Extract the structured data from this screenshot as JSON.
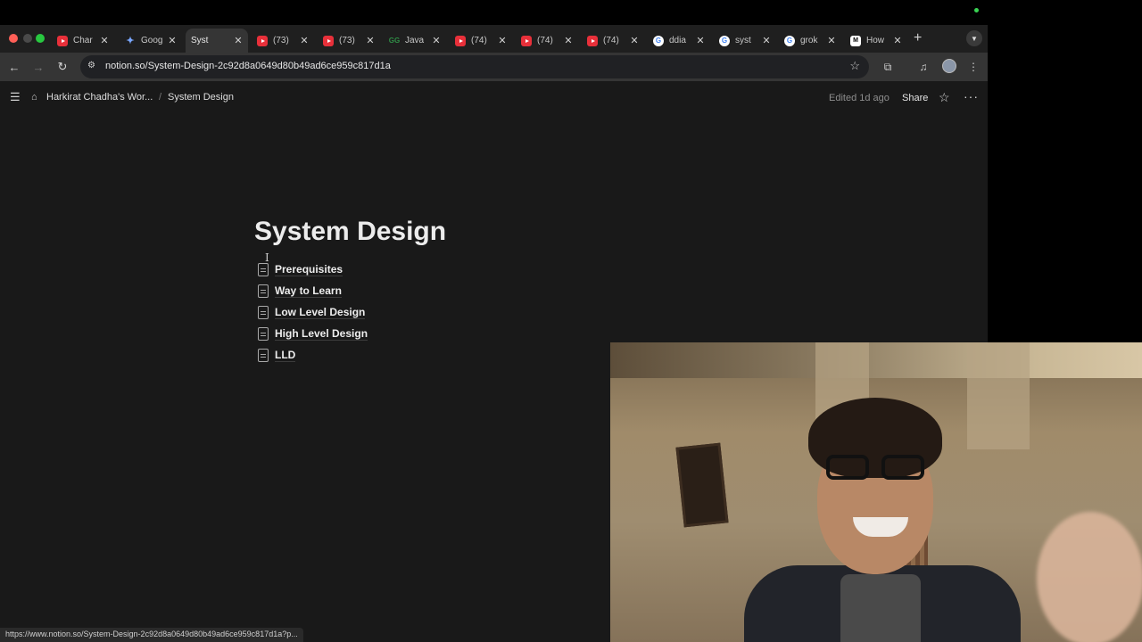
{
  "browser": {
    "tabs": [
      {
        "title": "Char",
        "favicon": "youtube-icon"
      },
      {
        "title": "Goog",
        "favicon": "gemini-icon"
      },
      {
        "title": "Syst",
        "favicon": "notion-icon",
        "active": true
      },
      {
        "title": "(73)",
        "favicon": "youtube-icon"
      },
      {
        "title": "(73)",
        "favicon": "youtube-icon"
      },
      {
        "title": "Java",
        "favicon": "geeksforgeeks-icon"
      },
      {
        "title": "(74)",
        "favicon": "youtube-icon"
      },
      {
        "title": "(74)",
        "favicon": "youtube-icon"
      },
      {
        "title": "(74)",
        "favicon": "youtube-icon"
      },
      {
        "title": "ddia",
        "favicon": "google-icon"
      },
      {
        "title": "syst",
        "favicon": "google-icon"
      },
      {
        "title": "grok",
        "favicon": "google-icon"
      },
      {
        "title": "How",
        "favicon": "medium-icon"
      }
    ],
    "url": "notion.so/System-Design-2c92d8a0649d80b49ad6ce959c817d1a",
    "status_url": "https://www.notion.so/System-Design-2c92d8a0649d80b49ad6ce959c817d1a?p..."
  },
  "notion": {
    "breadcrumb": {
      "workspace": "Harkirat Chadha's Wor...",
      "page": "System Design"
    },
    "edited": "Edited 1d ago",
    "share_label": "Share",
    "title": "System Design",
    "subpages": [
      {
        "label": "Prerequisites"
      },
      {
        "label": "Way to Learn"
      },
      {
        "label": "Low Level Design"
      },
      {
        "label": "High Level Design"
      },
      {
        "label": "LLD"
      }
    ]
  },
  "colors": {
    "notion_bg": "#191919",
    "tab_strip": "#1f1f1f",
    "toolbar": "#353535",
    "youtube_red": "#e8303a"
  }
}
